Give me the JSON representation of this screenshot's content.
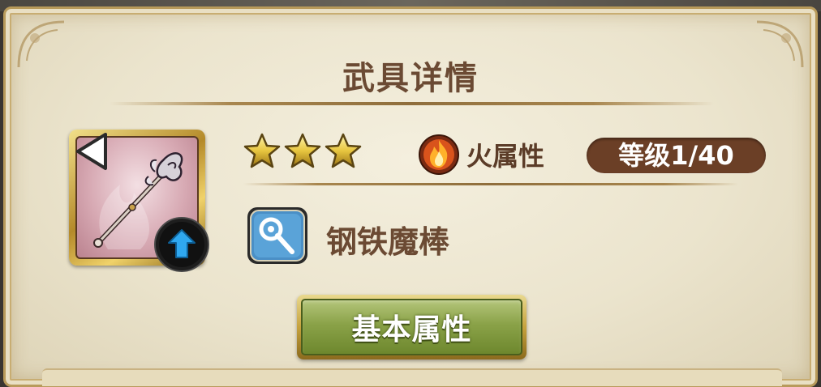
{
  "title": "武具详情",
  "weapon": {
    "name": "钢铁魔棒",
    "stars": 3,
    "element": "火属性",
    "level": "等级1/40",
    "icon": "staff-icon",
    "type_icon": "staff-type-icon"
  },
  "tabs": {
    "active_label": "基本属性"
  },
  "colors": {
    "panel": "#ebe4cd",
    "title": "#6b4a33",
    "level_pill": "#6b3f26",
    "tab_green": "#8aa248",
    "gold": "#c6a23e"
  }
}
